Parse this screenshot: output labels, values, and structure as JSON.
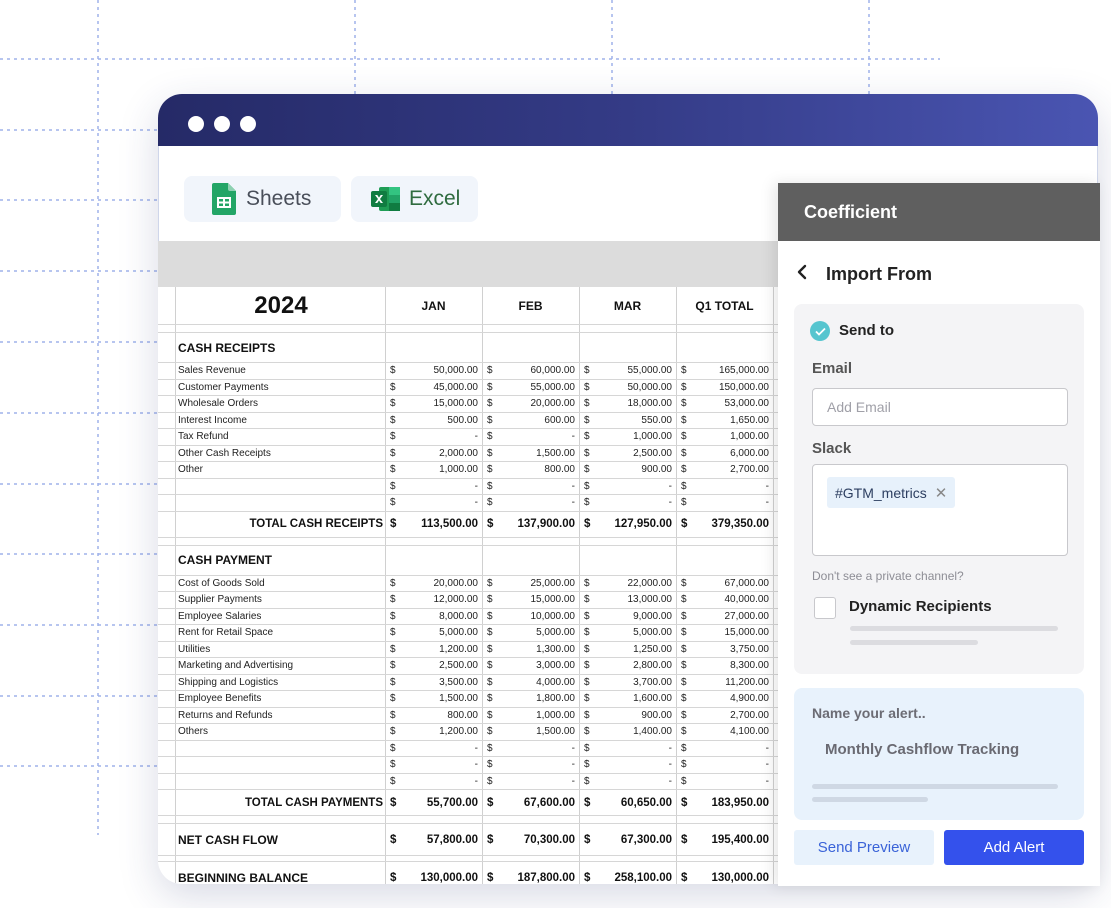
{
  "tabs": [
    {
      "label": "Sheets",
      "icon": "google-sheets-icon"
    },
    {
      "label": "Excel",
      "icon": "excel-icon"
    }
  ],
  "sheet": {
    "year": "2024",
    "columns": [
      "JAN",
      "FEB",
      "MAR",
      "Q1 TOTAL"
    ],
    "currency": "$",
    "receipts": {
      "title": "CASH RECEIPTS",
      "rows": [
        {
          "label": "Sales Revenue",
          "values": [
            "50,000.00",
            "60,000.00",
            "55,000.00",
            "165,000.00"
          ]
        },
        {
          "label": "Customer Payments",
          "values": [
            "45,000.00",
            "55,000.00",
            "50,000.00",
            "150,000.00"
          ]
        },
        {
          "label": "Wholesale Orders",
          "values": [
            "15,000.00",
            "20,000.00",
            "18,000.00",
            "53,000.00"
          ]
        },
        {
          "label": "Interest Income",
          "values": [
            "500.00",
            "600.00",
            "550.00",
            "1,650.00"
          ]
        },
        {
          "label": "Tax Refund",
          "values": [
            "-",
            "-",
            "1,000.00",
            "1,000.00"
          ]
        },
        {
          "label": "Other Cash Receipts",
          "values": [
            "2,000.00",
            "1,500.00",
            "2,500.00",
            "6,000.00"
          ]
        },
        {
          "label": "Other",
          "values": [
            "1,000.00",
            "800.00",
            "900.00",
            "2,700.00"
          ]
        },
        {
          "label": "",
          "values": [
            "-",
            "-",
            "-",
            "-"
          ]
        },
        {
          "label": "",
          "values": [
            "-",
            "-",
            "-",
            "-"
          ]
        }
      ],
      "total": {
        "label": "TOTAL CASH RECEIPTS",
        "values": [
          "113,500.00",
          "137,900.00",
          "127,950.00",
          "379,350.00"
        ]
      }
    },
    "payments": {
      "title": "CASH PAYMENT",
      "rows": [
        {
          "label": "Cost of Goods Sold",
          "values": [
            "20,000.00",
            "25,000.00",
            "22,000.00",
            "67,000.00"
          ]
        },
        {
          "label": "Supplier Payments",
          "values": [
            "12,000.00",
            "15,000.00",
            "13,000.00",
            "40,000.00"
          ]
        },
        {
          "label": "Employee Salaries",
          "values": [
            "8,000.00",
            "10,000.00",
            "9,000.00",
            "27,000.00"
          ]
        },
        {
          "label": "Rent for Retail Space",
          "values": [
            "5,000.00",
            "5,000.00",
            "5,000.00",
            "15,000.00"
          ]
        },
        {
          "label": "Utilities",
          "values": [
            "1,200.00",
            "1,300.00",
            "1,250.00",
            "3,750.00"
          ]
        },
        {
          "label": "Marketing and Advertising",
          "values": [
            "2,500.00",
            "3,000.00",
            "2,800.00",
            "8,300.00"
          ]
        },
        {
          "label": "Shipping and Logistics",
          "values": [
            "3,500.00",
            "4,000.00",
            "3,700.00",
            "11,200.00"
          ]
        },
        {
          "label": "Employee Benefits",
          "values": [
            "1,500.00",
            "1,800.00",
            "1,600.00",
            "4,900.00"
          ]
        },
        {
          "label": "Returns and Refunds",
          "values": [
            "800.00",
            "1,000.00",
            "900.00",
            "2,700.00"
          ]
        },
        {
          "label": "Others",
          "values": [
            "1,200.00",
            "1,500.00",
            "1,400.00",
            "4,100.00"
          ]
        },
        {
          "label": "",
          "values": [
            "-",
            "-",
            "-",
            "-"
          ]
        },
        {
          "label": "",
          "values": [
            "-",
            "-",
            "-",
            "-"
          ]
        },
        {
          "label": "",
          "values": [
            "-",
            "-",
            "-",
            "-"
          ]
        }
      ],
      "total": {
        "label": "TOTAL CASH PAYMENTS",
        "values": [
          "55,700.00",
          "67,600.00",
          "60,650.00",
          "183,950.00"
        ]
      }
    },
    "net": {
      "label": "NET CASH FLOW",
      "values": [
        "57,800.00",
        "70,300.00",
        "67,300.00",
        "195,400.00"
      ]
    },
    "beginning": {
      "label": "BEGINNING BALANCE",
      "values": [
        "130,000.00",
        "187,800.00",
        "258,100.00",
        "130,000.00"
      ]
    }
  },
  "panel": {
    "title": "Coefficient",
    "import_label": "Import From",
    "send_to": "Send to",
    "email_label": "Email",
    "email_placeholder": "Add Email",
    "slack_label": "Slack",
    "slack_channel": "#GTM_metrics",
    "hint": "Don't see a  private channel?",
    "dynamic_label": "Dynamic Recipients",
    "alert_label": "Name your alert..",
    "alert_name": "Monthly Cashflow Tracking",
    "preview_button": "Send Preview",
    "add_button": "Add Alert"
  },
  "colors": {
    "titlebar_start": "#252a67",
    "titlebar_end": "#4a55b2",
    "accent": "#3451ec",
    "check": "#56c5cf",
    "panel_header": "#5f5f5f"
  }
}
